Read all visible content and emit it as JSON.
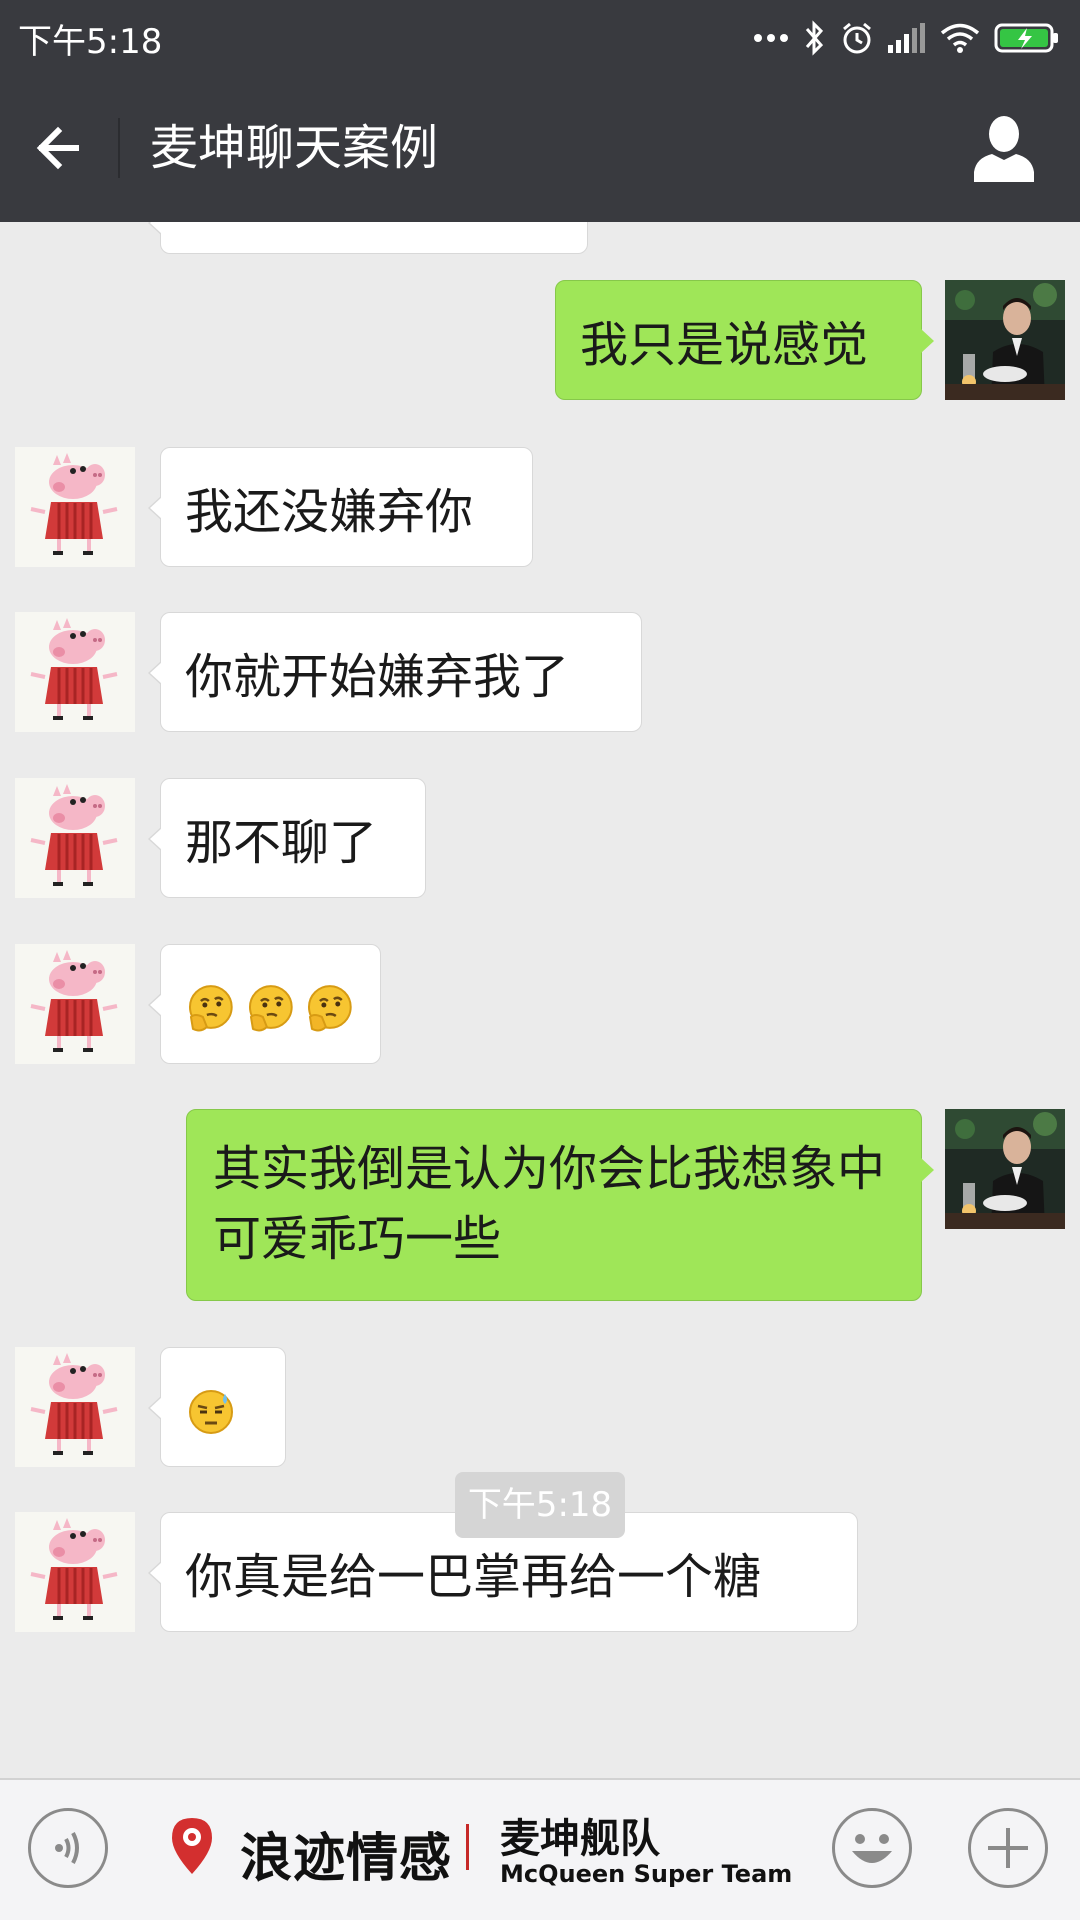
{
  "status_bar": {
    "time": "下午5:18",
    "icons": [
      "more-dots-icon",
      "bluetooth-icon",
      "alarm-icon",
      "signal-icon",
      "wifi-icon",
      "battery-charging-icon"
    ]
  },
  "header": {
    "title": "麦坤聊天案例",
    "back_icon": "back-arrow-icon",
    "profile_icon": "user-profile-icon",
    "background": "#393a3f"
  },
  "messages": [
    {
      "side": "out",
      "text": "我只是说感觉",
      "avatar": "photo-avatar"
    },
    {
      "side": "in",
      "text": "我还没嫌弃你",
      "avatar": "peppa-pig-avatar"
    },
    {
      "side": "in",
      "text": "你就开始嫌弃我了",
      "avatar": "peppa-pig-avatar"
    },
    {
      "side": "in",
      "text": "那不聊了",
      "avatar": "peppa-pig-avatar"
    },
    {
      "side": "in",
      "emoji": [
        "thinking-emoji",
        "thinking-emoji",
        "thinking-emoji"
      ],
      "avatar": "peppa-pig-avatar"
    },
    {
      "side": "out",
      "text": "其实我倒是认为你会比我想象中可爱乖巧一些",
      "avatar": "photo-avatar"
    },
    {
      "side": "in",
      "emoji": [
        "sweat-emoji"
      ],
      "avatar": "peppa-pig-avatar"
    },
    {
      "side": "in",
      "text": "你真是给一巴掌再给一个糖",
      "avatar": "peppa-pig-avatar"
    }
  ],
  "timestamp": "下午5:18",
  "bottom_bar": {
    "brand_name": "浪迹情感",
    "brand_team": "麦坤舰队",
    "brand_team_en": "McQueen Super Team",
    "voice_icon": "voice-icon",
    "emoji_icon": "emoji-face-icon",
    "plus_icon": "plus-icon"
  },
  "colors": {
    "outgoing_bubble": "#9fe658",
    "incoming_bubble": "#ffffff",
    "chat_background": "#ebebeb",
    "brand_red": "#c62828"
  }
}
